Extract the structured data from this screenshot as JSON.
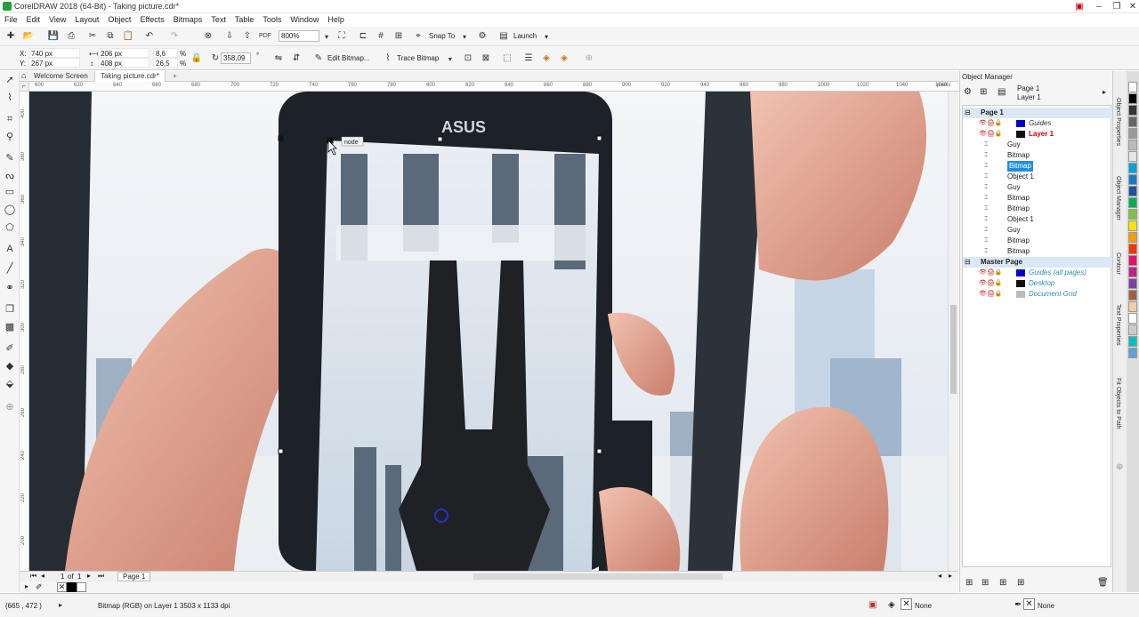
{
  "window": {
    "title": "CorelDRAW 2018 (64-Bit) - Taking picture.cdr*",
    "min": "–",
    "max": "❐",
    "close": "✕"
  },
  "menu": [
    "File",
    "Edit",
    "View",
    "Layout",
    "Object",
    "Effects",
    "Bitmaps",
    "Text",
    "Table",
    "Tools",
    "Window",
    "Help"
  ],
  "standard": {
    "zoom": "800%",
    "snap_to": "Snap To",
    "launch": "Launch"
  },
  "property": {
    "x_label": "X:",
    "x": "740 px",
    "y_label": "Y:",
    "y": "267 px",
    "w": "206 px",
    "h": "408 px",
    "sx": "8,6",
    "sy": "26,5",
    "pct1": "%",
    "pct2": "%",
    "angle": "358,09",
    "deg": "°",
    "edit_bitmap": "Edit Bitmap...",
    "trace_bitmap": "Trace Bitmap"
  },
  "tabs": {
    "welcome": "Welcome Screen",
    "doc": "Taking picture.cdr*",
    "add": "+"
  },
  "ruler": {
    "h_ticks": [
      "600",
      "620",
      "640",
      "660",
      "680",
      "700",
      "720",
      "740",
      "760",
      "780",
      "800",
      "820",
      "840",
      "860",
      "880",
      "900",
      "920",
      "940",
      "960",
      "980",
      "1000",
      "1020",
      "1040",
      "1060"
    ],
    "h_unit": "pixels",
    "v_ticks": [
      "400",
      "380",
      "360",
      "340",
      "320",
      "300",
      "280",
      "260",
      "240",
      "220",
      "200"
    ]
  },
  "canvas": {
    "node_label": "node",
    "brand": "ASUS"
  },
  "pagenav": {
    "current": "1",
    "of": "of",
    "total": "1",
    "page_tab": "Page 1"
  },
  "status": {
    "coords": "(665 , 472 )",
    "info": "Bitmap (RGB) on Layer 1 3503 x 1133 dpi",
    "fill": "None",
    "outline": "None"
  },
  "object_manager": {
    "title": "Object Manager",
    "header_page": "Page 1",
    "header_layer": "Layer 1",
    "tree": [
      {
        "label": "Page 1",
        "indent": 0,
        "kind": "page"
      },
      {
        "label": "Guides",
        "indent": 1,
        "kind": "guides"
      },
      {
        "label": "Layer 1",
        "indent": 1,
        "kind": "layer"
      },
      {
        "label": "Guy",
        "indent": 2,
        "kind": "obj"
      },
      {
        "label": "Bitmap",
        "indent": 2,
        "kind": "obj"
      },
      {
        "label": "Bitmap",
        "indent": 2,
        "kind": "selected"
      },
      {
        "label": "Object 1",
        "indent": 2,
        "kind": "obj"
      },
      {
        "label": "Guy",
        "indent": 2,
        "kind": "obj"
      },
      {
        "label": "Bitmap",
        "indent": 2,
        "kind": "obj"
      },
      {
        "label": "Bitmap",
        "indent": 2,
        "kind": "obj"
      },
      {
        "label": "Object 1",
        "indent": 2,
        "kind": "obj"
      },
      {
        "label": "Guy",
        "indent": 2,
        "kind": "obj"
      },
      {
        "label": "Bitmap",
        "indent": 2,
        "kind": "obj"
      },
      {
        "label": "Bitmap",
        "indent": 2,
        "kind": "obj"
      },
      {
        "label": "Master Page",
        "indent": 0,
        "kind": "page"
      },
      {
        "label": "Guides (all pages)",
        "indent": 1,
        "kind": "master"
      },
      {
        "label": "Desktop",
        "indent": 1,
        "kind": "master"
      },
      {
        "label": "Document Grid",
        "indent": 1,
        "kind": "master"
      }
    ]
  },
  "side_tabs": [
    "Object Properties",
    "Object Manager",
    "Contour",
    "Text Properties",
    "Fit Objects to Path"
  ],
  "palette": [
    "#ffffff",
    "#000000",
    "#333333",
    "#666666",
    "#999999",
    "#bbbbbb",
    "#e6e6e6",
    "#00a0e0",
    "#1a7ac0",
    "#2050a0",
    "#00b050",
    "#80c040",
    "#ffe000",
    "#ff9900",
    "#ff3300",
    "#e0106a",
    "#c0208a",
    "#8040a0",
    "#a06040",
    "#f0d0a0",
    "#ffffff",
    "#cccccc",
    "#00c0c0",
    "#60a0e0"
  ]
}
